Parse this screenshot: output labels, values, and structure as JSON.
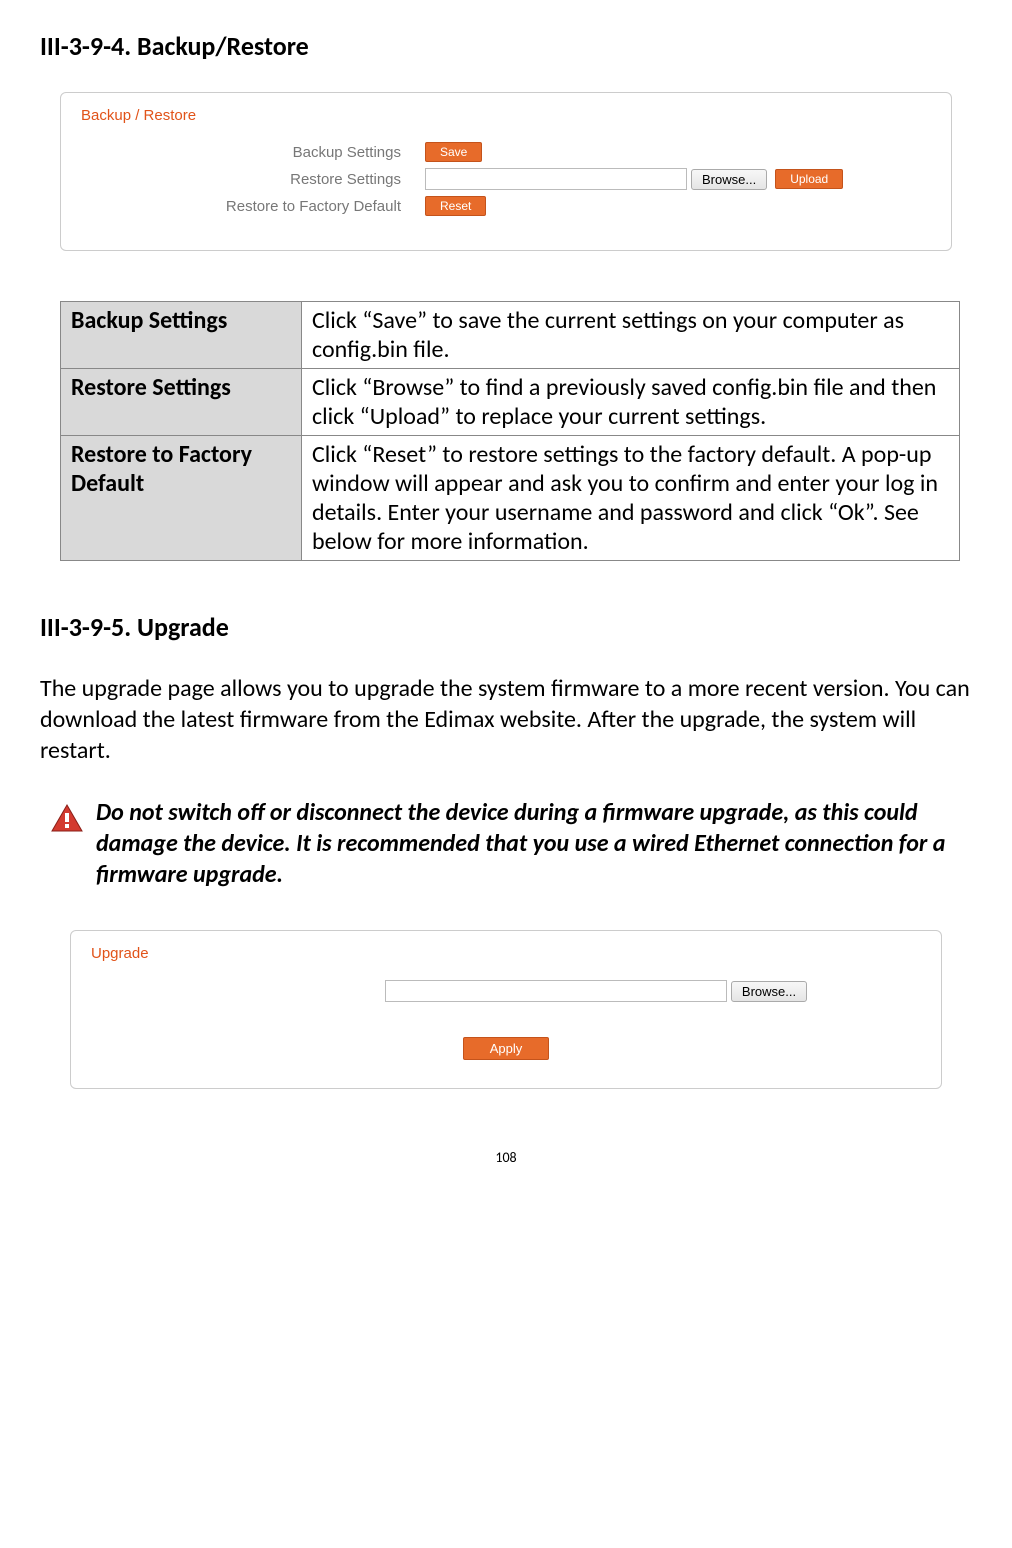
{
  "section1": {
    "heading": "III-3-9-4.    Backup/Restore",
    "panel": {
      "title": "Backup / Restore",
      "rows": {
        "r0": {
          "label": "Backup Settings",
          "btn": "Save"
        },
        "r1": {
          "label": "Restore Settings",
          "browse": "Browse...",
          "upload": "Upload"
        },
        "r2": {
          "label": "Restore to Factory Default",
          "btn": "Reset"
        }
      }
    },
    "table": {
      "r0": {
        "label": "Backup Settings",
        "desc": "Click “Save” to save the current settings on your computer as config.bin file."
      },
      "r1": {
        "label": "Restore Settings",
        "desc": "Click “Browse” to find a previously saved config.bin file and then click “Upload” to replace your current settings."
      },
      "r2": {
        "label": "Restore to Factory Default",
        "desc": "Click “Reset” to restore settings to the factory default. A pop-up window will appear and ask you to confirm and enter your log in details. Enter your username and password and click “Ok”. See below for more information."
      }
    }
  },
  "section2": {
    "heading": "III-3-9-5.    Upgrade",
    "para": "The upgrade page allows you to upgrade the system firmware to a more recent version. You can download the latest firmware from the Edimax website. After the upgrade, the system will restart.",
    "warning": "Do not switch off or disconnect the device during a firmware upgrade, as this could damage the device. It is recommended that you use a wired Ethernet connection for a firmware upgrade.",
    "panel": {
      "title": "Upgrade",
      "browse": "Browse...",
      "apply": "Apply"
    }
  },
  "page": "108"
}
